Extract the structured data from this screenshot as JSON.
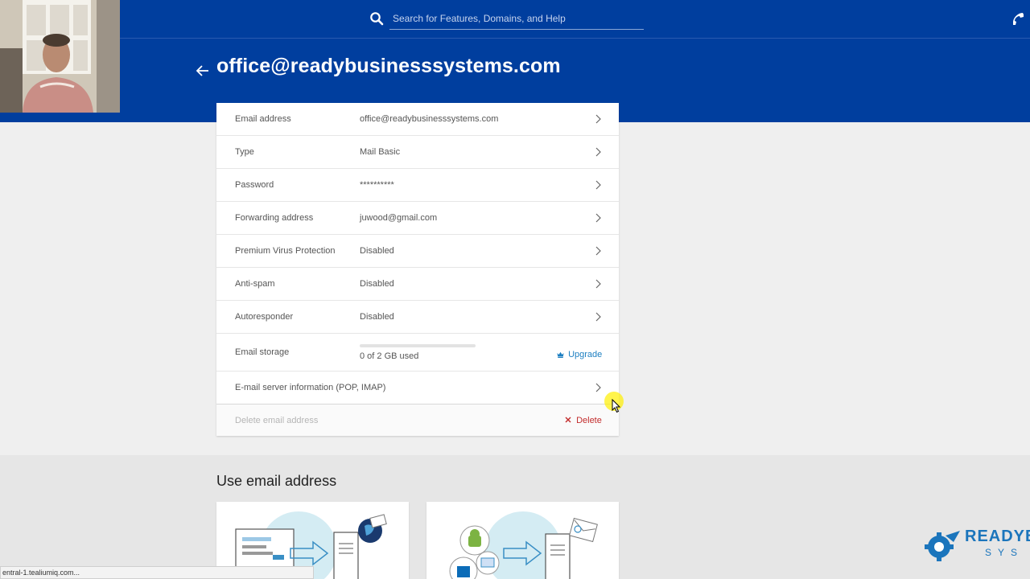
{
  "search": {
    "placeholder": "Search for Features, Domains, and Help"
  },
  "header": {
    "title": "office@readybusinesssystems.com"
  },
  "details": {
    "rows": [
      {
        "label": "Email address",
        "value": "office@readybusinesssystems.com"
      },
      {
        "label": "Type",
        "value": "Mail Basic"
      },
      {
        "label": "Password",
        "value": "**********"
      },
      {
        "label": "Forwarding address",
        "value": "juwood@gmail.com"
      },
      {
        "label": "Premium Virus Protection",
        "value": "Disabled"
      },
      {
        "label": "Anti-spam",
        "value": "Disabled"
      },
      {
        "label": "Autoresponder",
        "value": "Disabled"
      }
    ],
    "storage": {
      "label": "Email storage",
      "used_text": "0 of 2 GB used",
      "used_fraction": 0,
      "upgrade_label": "Upgrade"
    },
    "server_info": {
      "label": "E-mail server information (POP, IMAP)"
    },
    "delete": {
      "label": "Delete email address",
      "button_label": "Delete"
    }
  },
  "use_section": {
    "title": "Use email address"
  },
  "status_bar": {
    "url": "entral-1.tealiumiq.com..."
  },
  "brand": {
    "ready": "READYB",
    "sys": "SYS"
  },
  "colors": {
    "header_blue": "#003e9e",
    "link_blue": "#1d7fc1",
    "delete_red": "#c32d2d"
  },
  "icons": [
    "search-icon",
    "phone-icon",
    "back-arrow-icon",
    "chevron-right-icon",
    "crown-icon",
    "close-icon"
  ]
}
